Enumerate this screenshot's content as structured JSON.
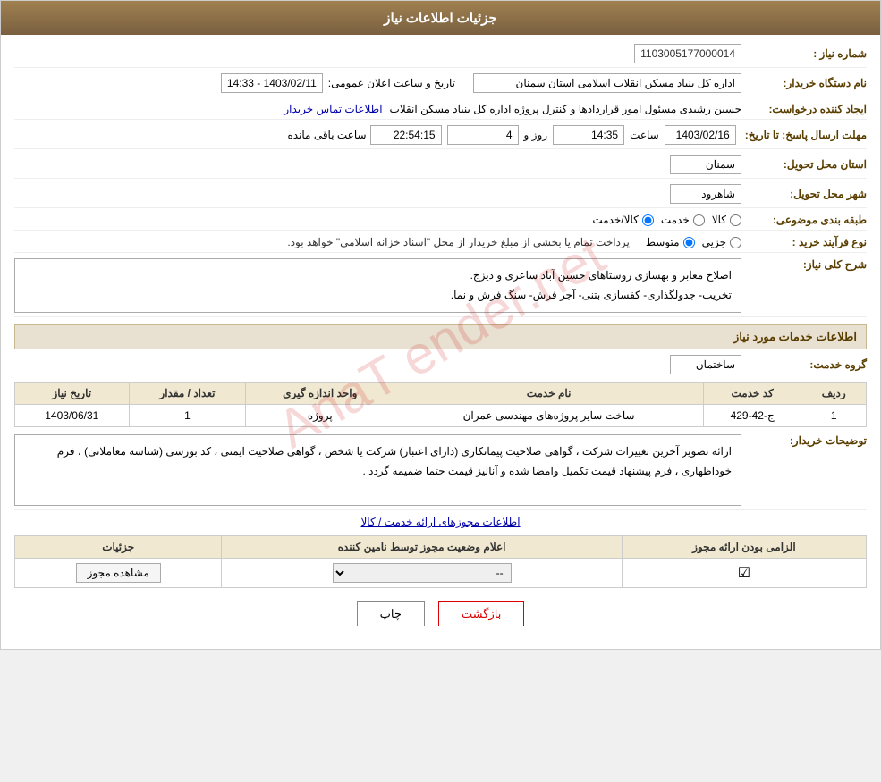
{
  "header": {
    "title": "جزئیات اطلاعات نیاز"
  },
  "fields": {
    "request_number_label": "شماره نیاز :",
    "request_number_value": "1103005177000014",
    "buyer_org_label": "نام دستگاه خریدار:",
    "buyer_org_value": "اداره کل بنیاد مسکن انقلاب اسلامی استان سمنان",
    "creator_label": "ایجاد کننده درخواست:",
    "creator_value": "حسین رشیدی مسئول امور قراردادها و کنترل پروژه اداره کل بنیاد مسکن انقلاب",
    "contact_link": "اطلاعات تماس خریدار",
    "deadline_label": "مهلت ارسال پاسخ: تا تاریخ:",
    "deadline_date": "1403/02/16",
    "deadline_time": "14:35",
    "deadline_days": "4",
    "deadline_remaining": "22:54:15",
    "announce_label": "تاریخ و ساعت اعلان عمومی:",
    "announce_value": "1403/02/11 - 14:33",
    "province_label": "استان محل تحویل:",
    "province_value": "سمنان",
    "city_label": "شهر محل تحویل:",
    "city_value": "شاهرود",
    "category_label": "طبقه بندی موضوعی:",
    "category_kala": "کالا",
    "category_khadamat": "خدمت",
    "category_kala_khadamat": "کالا/خدمت",
    "category_selected": "کالا/خدمت",
    "process_label": "نوع فرآیند خرید :",
    "process_jozii": "جزیی",
    "process_motavaset": "متوسط",
    "process_note": "پرداخت تمام یا بخشی از مبلغ خریدار از محل \"اسناد خزانه اسلامی\" خواهد بود.",
    "description_header": "شرح کلی نیاز:",
    "description_text_line1": "اصلاح معابر و بهسازی روستاهای حسین آباد ساعری و دیزج.",
    "description_text_line2": "تخریب- جدولگذاری- کفسازی بتنی- آجر فرش- سنگ فرش و نما.",
    "services_header": "اطلاعات خدمات مورد نیاز",
    "service_group_label": "گروه خدمت:",
    "service_group_value": "ساختمان",
    "table_headers": {
      "row_num": "ردیف",
      "service_code": "کد خدمت",
      "service_name": "نام خدمت",
      "unit": "واحد اندازه گیری",
      "count": "تعداد / مقدار",
      "date": "تاریخ نیاز"
    },
    "table_rows": [
      {
        "row_num": "1",
        "service_code": "ج-42-429",
        "service_name": "ساخت سایر پروژه‌های مهندسی عمران",
        "unit": "پروژه",
        "count": "1",
        "date": "1403/06/31"
      }
    ],
    "buyer_notes_label": "توضیحات خریدار:",
    "buyer_notes_text": "ارائه تصویر آخرین تغییرات شرکت ، گواهی صلاحیت پیمانکاری (دارای اعتبار) شرکت یا شخص ، گواهی صلاحیت ایمنی ، کد بورسی (شناسه معاملاتی) ، فرم خوداظهاری ، فرم پیشنهاد قیمت تکمیل وامضا شده و آنالیز قیمت حتما ضمیمه گردد .",
    "license_link": "اطلاعات مجوزهای ارائه خدمت / کالا",
    "license_table_headers": {
      "required": "الزامی بودن ارائه مجوز",
      "status": "اعلام وضعیت مجوز توسط نامین کننده",
      "details": "جزئیات"
    },
    "license_rows": [
      {
        "required_checked": true,
        "status_value": "--",
        "details_button": "مشاهده مجوز"
      }
    ],
    "btn_print": "چاپ",
    "btn_back": "بازگشت"
  }
}
